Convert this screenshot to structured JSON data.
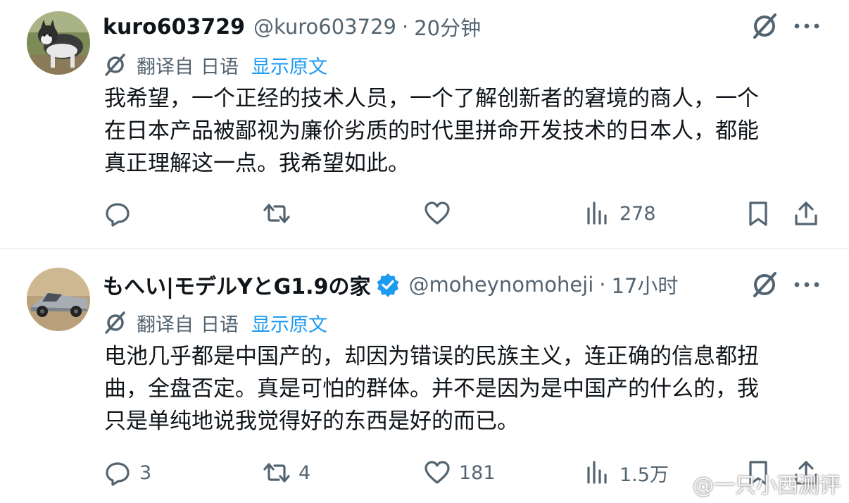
{
  "posts": [
    {
      "display_name": "kuro603729",
      "handle": "@kuro603729",
      "separator": "·",
      "time": "20分钟",
      "translate_label": "翻译自",
      "language": "日语",
      "show_original": "显示原文",
      "text_lines": [
        "我希望，一个正经的技术人员，一个了解创新者的窘境的商人，一个",
        "在日本产品被鄙视为廉价劣质的时代里拼命开发技术的日本人，都能",
        "真正理解这一点。我希望如此。"
      ],
      "reply_count": "",
      "repost_count": "",
      "like_count": "",
      "views": "278",
      "avatar_icon": "husky-dog-avatar"
    },
    {
      "display_name": "もへい|モデルYとG1.9の家",
      "verified": true,
      "handle": "@moheynomoheji",
      "separator": "·",
      "time": "17小时",
      "translate_label": "翻译自",
      "language": "日语",
      "show_original": "显示原文",
      "text_lines": [
        "电池几乎都是中国产的，却因为错误的民族主义，连正确的信息都扭",
        "曲，全盘否定。真是可怕的群体。并不是因为是中国产的什么的，我",
        "只是单纯地说我觉得好的东西是好的而已。"
      ],
      "reply_count": "3",
      "repost_count": "4",
      "like_count": "181",
      "views": "1.5万",
      "avatar_icon": "cybertruck-avatar"
    }
  ],
  "watermark": "@一只小西测评",
  "colors": {
    "text": "#0f1419",
    "secondary": "#536471",
    "link": "#1d9bf0",
    "verified": "#1d9bf0",
    "divider": "#eff3f4"
  }
}
